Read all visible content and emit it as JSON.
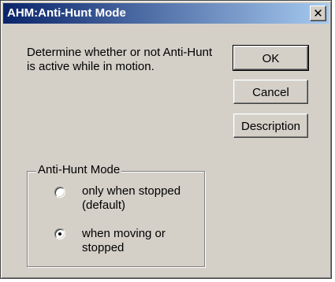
{
  "window": {
    "title": "AHM:Anti-Hunt Mode",
    "close_glyph": "✕"
  },
  "description": "Determine whether or not Anti-Hunt is active while in motion.",
  "buttons": {
    "ok": "OK",
    "cancel": "Cancel",
    "description": "Description"
  },
  "group": {
    "label": "Anti-Hunt Mode",
    "options": [
      {
        "label": "only when stopped (default)",
        "selected": false
      },
      {
        "label": "when moving or stopped",
        "selected": true
      }
    ]
  }
}
